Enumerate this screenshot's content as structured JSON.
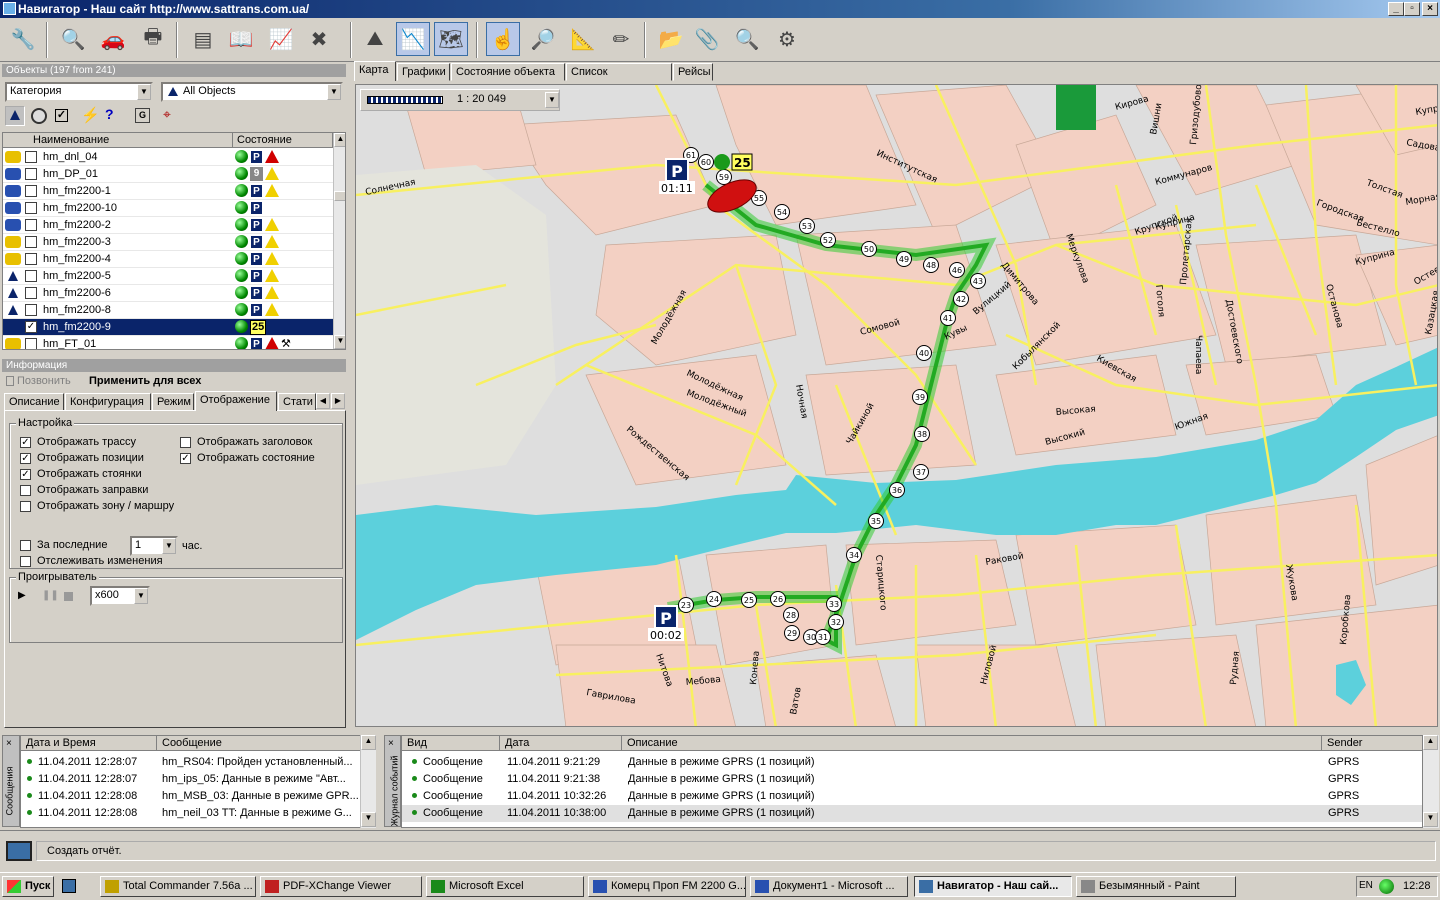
{
  "window": {
    "title": "Навигатор  - Наш сайт http://www.sattrans.com.ua/"
  },
  "toolbar": {
    "buttons": [
      "settings",
      "search-objects",
      "vehicles",
      "print",
      "reports",
      "book",
      "chart",
      "remove",
      "roads",
      "graph",
      "map-view",
      "tools",
      "zoom",
      "measure",
      "edit",
      "open-folder",
      "clip",
      "find",
      "config"
    ]
  },
  "objects_panel": {
    "header": "Объекты (197 from 241)",
    "category_value": "Категория",
    "filter_value": "All Objects",
    "columns": [
      "Наименование",
      "Состояние"
    ],
    "rows": [
      {
        "name": "hm_dnl_04",
        "checked": false,
        "status": [
          "online",
          "parking",
          "alarm"
        ],
        "selected": false
      },
      {
        "name": "hm_DP_01",
        "checked": false,
        "status": [
          "online",
          "9",
          "warning"
        ],
        "selected": false
      },
      {
        "name": "hm_fm2200-1",
        "checked": false,
        "status": [
          "online",
          "parking",
          "warning"
        ],
        "selected": false
      },
      {
        "name": "hm_fm2200-10",
        "checked": false,
        "status": [
          "online",
          "parking"
        ],
        "selected": false
      },
      {
        "name": "hm_fm2200-2",
        "checked": false,
        "status": [
          "online",
          "parking",
          "warning"
        ],
        "selected": false
      },
      {
        "name": "hm_fm2200-3",
        "checked": false,
        "status": [
          "online",
          "parking",
          "warning"
        ],
        "selected": false
      },
      {
        "name": "hm_fm2200-4",
        "checked": false,
        "status": [
          "online",
          "parking",
          "warning"
        ],
        "selected": false
      },
      {
        "name": "hm_fm2200-5",
        "checked": false,
        "status": [
          "online",
          "parking",
          "warning"
        ],
        "selected": false
      },
      {
        "name": "hm_fm2200-6",
        "checked": false,
        "status": [
          "online",
          "parking",
          "warning"
        ],
        "selected": false
      },
      {
        "name": "hm_fm2200-8",
        "checked": false,
        "status": [
          "online",
          "parking",
          "warning"
        ],
        "selected": false
      },
      {
        "name": "hm_fm2200-9",
        "checked": true,
        "status": [
          "online",
          "25"
        ],
        "selected": true
      },
      {
        "name": "hm_FT_01",
        "checked": false,
        "status": [
          "online",
          "parking",
          "alarm",
          "hammer"
        ],
        "selected": false
      }
    ]
  },
  "info_panel": {
    "header": "Информация",
    "call_label": "Позвонить",
    "apply_all_label": "Применить для всех",
    "tabs": [
      "Описание",
      "Конфигурация",
      "Режим",
      "Отображение",
      "Стати"
    ],
    "active_tab": "Отображение",
    "settings_group": "Настройка",
    "options_left": [
      {
        "label": "Отображать трассу",
        "checked": true
      },
      {
        "label": "Отображать позиции",
        "checked": true
      },
      {
        "label": "Отображать стоянки",
        "checked": true
      },
      {
        "label": "Отображать заправки",
        "checked": false
      },
      {
        "label": "Отображать зону / маршру",
        "checked": false
      }
    ],
    "options_right": [
      {
        "label": "Отображать заголовок",
        "checked": false
      },
      {
        "label": "Отображать состояние",
        "checked": true
      }
    ],
    "last_label": "За последние",
    "last_value": "1",
    "last_unit": "час.",
    "track_changes_label": "Отслеживать изменения",
    "player_group": "Проигрыватель",
    "player_speed": "x600"
  },
  "map_tabs": [
    "Карта",
    "Графики",
    "Состояние объекта",
    "Список маршрутов",
    "Рейсы"
  ],
  "map": {
    "scale": "1 : 20 049",
    "park_start_time": "00:02",
    "park_end_time": "01:11",
    "vehicle_speed": "25",
    "points": [
      "23",
      "24",
      "25",
      "26",
      "28",
      "29",
      "30",
      "31",
      "32",
      "33",
      "34",
      "35",
      "36",
      "37",
      "38",
      "39",
      "40",
      "41",
      "42",
      "43",
      "46",
      "48",
      "49",
      "50",
      "52",
      "53",
      "54",
      "55",
      "59",
      "60",
      "61"
    ],
    "streets": [
      "Солнечная",
      "Институтская",
      "Молодёжная",
      "Молодёжная",
      "Молодёжный",
      "Рождественская",
      "Ночная",
      "Чайкиной",
      "Сомовой",
      "Кувы",
      "Димитрова",
      "Меркулова",
      "Кобылянской",
      "Киевская",
      "Высокий",
      "Высокая",
      "Южная",
      "Крупской",
      "Коммунаров",
      "Гоголя",
      "Пролетарская",
      "Чапаева",
      "Достоевского",
      "Куприна",
      "Куприна",
      "Городская",
      "Бестелло",
      "Толстая",
      "Кирова",
      "Гризодубовой",
      "Раковой",
      "Старицкого",
      "Гаврилова",
      "Нитова",
      "Мебова",
      "Ватов",
      "Конева",
      "Ниловой",
      "Жукова",
      "Рудная",
      "Коробкова",
      "Останова",
      "Вишни",
      "Остеева",
      "Морная",
      "Садова",
      "Куприна",
      "Казацкая",
      "Вулицкий"
    ]
  },
  "messages_panel": {
    "side_label": "Сообщения",
    "columns": [
      "Дата и Время",
      "Сообщение"
    ],
    "rows": [
      {
        "time": "11.04.2011 12:28:07",
        "text": "hm_RS04: Пройден установленный..."
      },
      {
        "time": "11.04.2011 12:28:07",
        "text": "hm_ips_05: Данные в режиме \"Авт..."
      },
      {
        "time": "11.04.2011 12:28:08",
        "text": "hm_MSB_03: Данные в режиме GPR..."
      },
      {
        "time": "11.04.2011 12:28:08",
        "text": "hm_neil_03 TT: Данные в режиме G..."
      }
    ]
  },
  "events_panel": {
    "side_label": "Журнал событий",
    "columns": [
      "Вид",
      "Дата",
      "Описание",
      "Sender"
    ],
    "rows": [
      {
        "kind": "Сообщение",
        "date": "11.04.2011 9:21:29",
        "desc": "Данные в режиме GPRS (1 позиций)",
        "sender": "GPRS"
      },
      {
        "kind": "Сообщение",
        "date": "11.04.2011 9:21:38",
        "desc": "Данные в режиме GPRS (1 позиций)",
        "sender": "GPRS"
      },
      {
        "kind": "Сообщение",
        "date": "11.04.2011 10:32:26",
        "desc": "Данные в режиме GPRS (1 позиций)",
        "sender": "GPRS"
      },
      {
        "kind": "Сообщение",
        "date": "11.04.2011 10:38:00",
        "desc": "Данные в режиме GPRS (1 позиций)",
        "sender": "GPRS"
      }
    ]
  },
  "statusbar": {
    "text": "Создать отчёт."
  },
  "taskbar": {
    "start": "Пуск",
    "tasks": [
      {
        "label": "Total Commander 7.56a ...",
        "active": false
      },
      {
        "label": "PDF-XChange Viewer",
        "active": false
      },
      {
        "label": "Microsoft Excel",
        "active": false
      },
      {
        "label": "Комерц Проп FM 2200 G...",
        "active": false
      },
      {
        "label": "Документ1 - Microsoft ...",
        "active": false
      },
      {
        "label": "Навигатор  - Наш сай...",
        "active": true
      },
      {
        "label": "Безымянный - Paint",
        "active": false
      }
    ],
    "lang": "EN",
    "clock": "12:28"
  },
  "colors": {
    "accent": "#0a246a",
    "map_bg": "#dedede",
    "block": "#f3d0c3",
    "water": "#5cd0dc",
    "road": "#f8f060",
    "route": "#33cc33"
  }
}
